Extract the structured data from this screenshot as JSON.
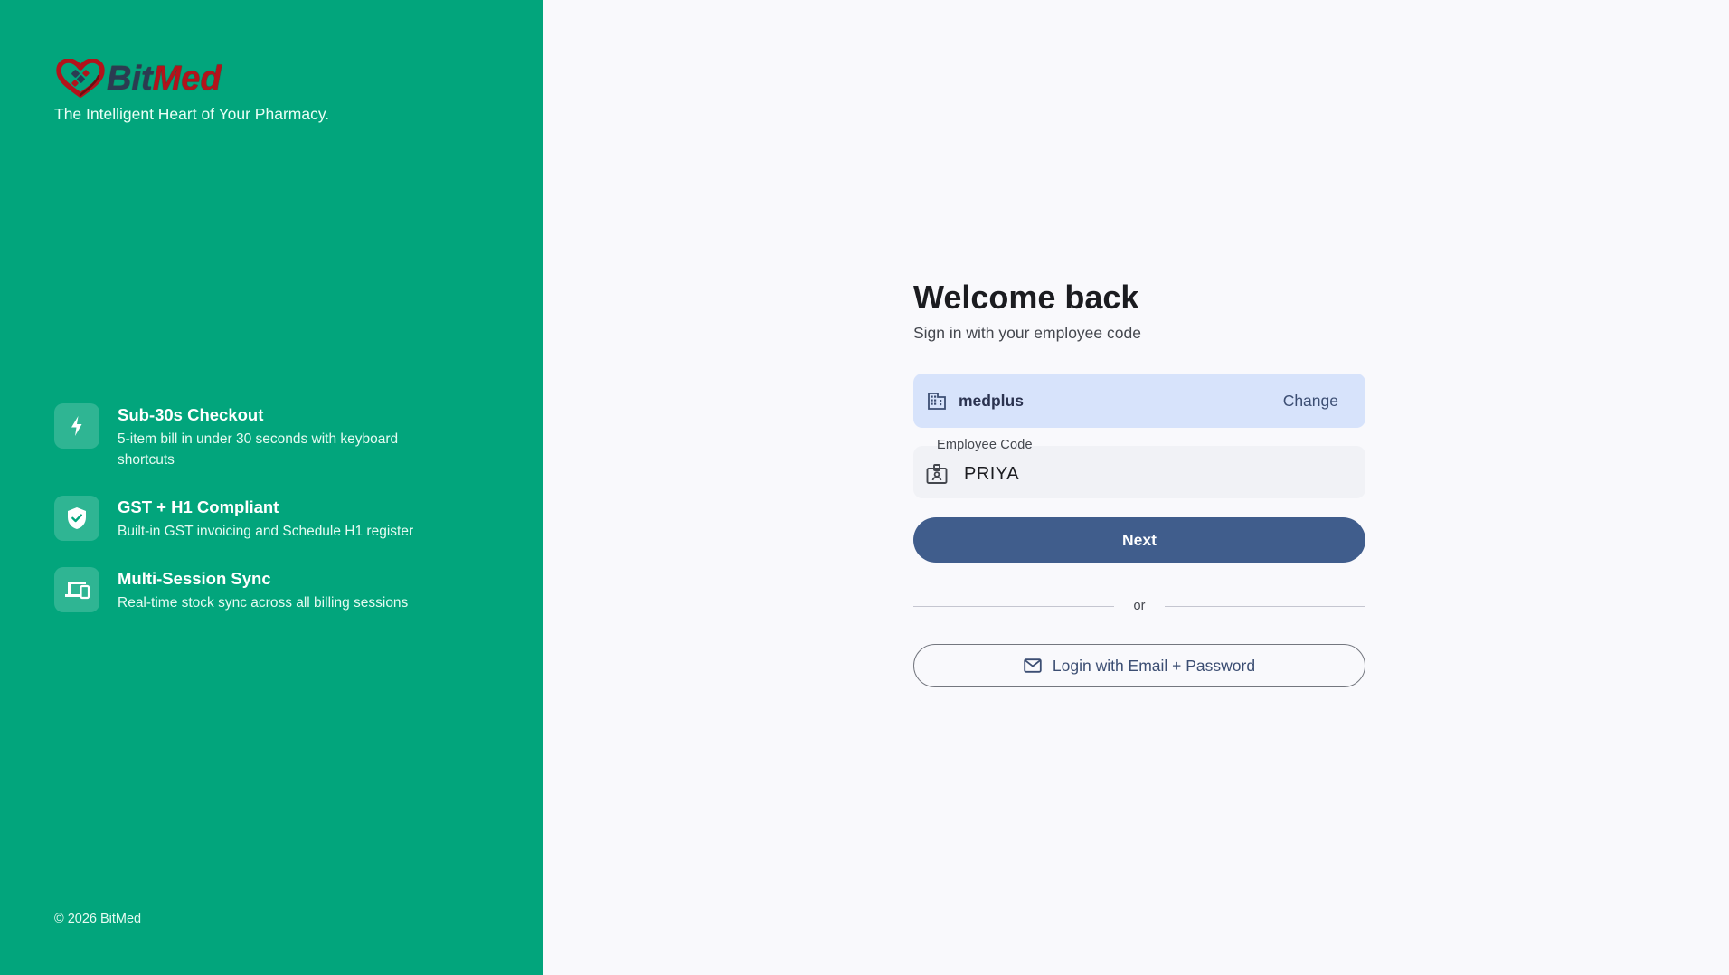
{
  "brand": {
    "logo_part1": "Bit",
    "logo_part2": "Med",
    "tagline": "The Intelligent Heart of Your Pharmacy.",
    "colors": {
      "panel": "#02a57c",
      "logo_red": "#b3131b",
      "logo_dark": "#2b3b52"
    }
  },
  "features": [
    {
      "icon": "bolt-icon",
      "title": "Sub-30s Checkout",
      "description": "5-item bill in under 30 seconds with keyboard shortcuts"
    },
    {
      "icon": "shield-check-icon",
      "title": "GST + H1 Compliant",
      "description": "Built-in GST invoicing and Schedule H1 register"
    },
    {
      "icon": "devices-icon",
      "title": "Multi-Session Sync",
      "description": "Real-time stock sync across all billing sessions"
    }
  ],
  "footer": {
    "copyright": "© 2026 BitMed"
  },
  "login": {
    "title": "Welcome back",
    "subtitle": "Sign in with your employee code",
    "tenant": {
      "icon": "building-icon",
      "name": "medplus",
      "change_label": "Change"
    },
    "employee_code": {
      "label": "Employee Code",
      "value": "PRIYA",
      "icon": "id-badge-icon"
    },
    "next_label": "Next",
    "divider_label": "or",
    "email_login": {
      "icon": "mail-icon",
      "label": "Login with Email + Password"
    },
    "colors": {
      "primary": "#405d8c",
      "tenant_bg": "#d7e3fb",
      "background": "#f9f9fc"
    }
  }
}
